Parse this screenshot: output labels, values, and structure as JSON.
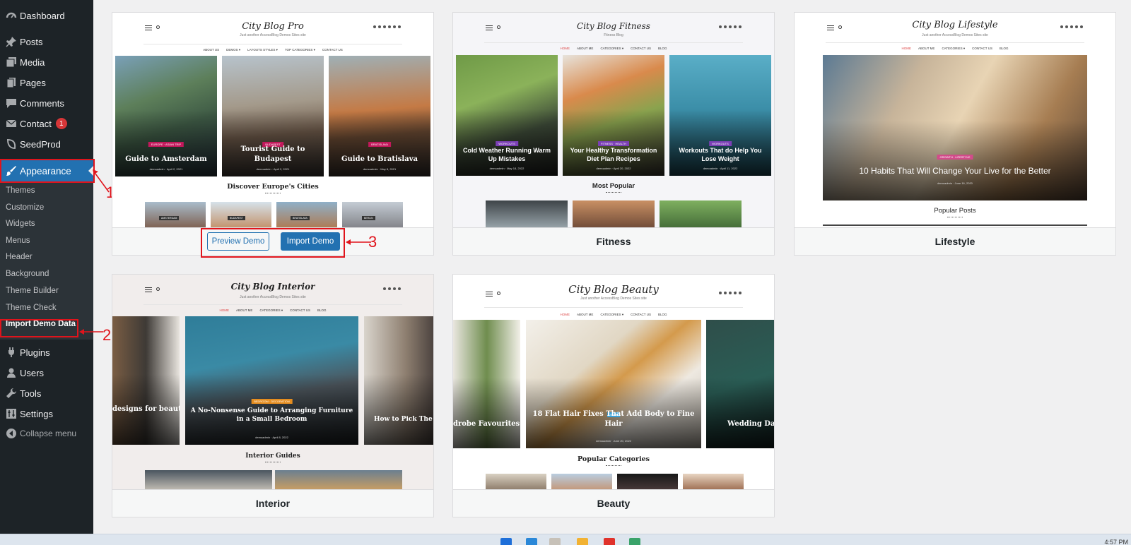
{
  "sidebar": {
    "menu": [
      {
        "label": "Dashboard",
        "icon": "dashboard-icon"
      },
      {
        "label": "Posts",
        "icon": "pin-icon"
      },
      {
        "label": "Media",
        "icon": "media-icon"
      },
      {
        "label": "Pages",
        "icon": "pages-icon"
      },
      {
        "label": "Comments",
        "icon": "comments-icon"
      },
      {
        "label": "Contact",
        "icon": "mail-icon",
        "badge": "1"
      },
      {
        "label": "SeedProd",
        "icon": "seedprod-icon"
      },
      {
        "label": "Appearance",
        "icon": "brush-icon"
      },
      {
        "label": "Plugins",
        "icon": "plugin-icon"
      },
      {
        "label": "Users",
        "icon": "users-icon"
      },
      {
        "label": "Tools",
        "icon": "wrench-icon"
      },
      {
        "label": "Settings",
        "icon": "settings-icon"
      },
      {
        "label": "Collapse menu",
        "icon": "collapse-icon"
      }
    ],
    "submenu": [
      "Themes",
      "Customize",
      "Widgets",
      "Menus",
      "Header",
      "Background",
      "Theme Builder",
      "Theme Check",
      "Import Demo Data"
    ]
  },
  "annotations": {
    "one": "1",
    "two": "2",
    "three": "3"
  },
  "cards": {
    "pro": {
      "name": "",
      "site_title": "City Blog Pro",
      "tagline": "Just another AccessBlog Demos Sites site",
      "nav": [
        "ABOUT US",
        "DEMOS ▾",
        "LAYOUTS STYLES ▾",
        "TOP CATEGORIES ▾",
        "CONTACT US"
      ],
      "posts": [
        {
          "title": "Guide to Amsterdam",
          "tag": "EUROPE · ASIAN TRIP",
          "meta": "demoadmin · April 2, 2021"
        },
        {
          "title": "Tourist Guide to Budapest",
          "tag": "BUDAPEST",
          "meta": "demoadmin · April 2, 2021"
        },
        {
          "title": "Guide to Bratislava",
          "tag": "BRATISLAVA",
          "meta": "demoadmin · May 8, 2021"
        }
      ],
      "section": "Discover Europe's Cities",
      "mini_labels": [
        "AMSTERDAM",
        "BUDAPEST",
        "BRATISLAVA",
        "BERLIN"
      ],
      "preview_label": "Preview Demo",
      "import_label": "Import Demo"
    },
    "fitness": {
      "name": "Fitness",
      "site_title": "City Blog Fitness",
      "tagline": "Fitness Blog",
      "nav": [
        "HOME",
        "ABOUT ME",
        "CATEGORIES ▾",
        "CONTACT US",
        "BLOG"
      ],
      "posts": [
        {
          "title": "Cold Weather Running Warm Up Mistakes",
          "tag": "WORKOUTS",
          "meta": "demoadmin · May 18, 2022"
        },
        {
          "title": "Your Healthy Transformation Diet Plan Recipes",
          "tag": "FITNESS · HEALTH",
          "meta": "demoadmin · April 20, 2022"
        },
        {
          "title": "Workouts That do Help You Lose Weight",
          "tag": "WORKOUTS",
          "meta": "demoadmin · April 11, 2022"
        }
      ],
      "section": "Most Popular"
    },
    "lifestyle": {
      "name": "Lifestyle",
      "site_title": "City Blog Lifestyle",
      "tagline": "Just another AccessBlog Demos Sites site",
      "nav": [
        "HOME",
        "ABOUT ME",
        "CATEGORIES ▾",
        "CONTACT US",
        "BLOG"
      ],
      "post": {
        "title": "10 Habits That Will Change Your Live for the Better",
        "tag": "GROWTH · LIFESTYLE",
        "meta": "demoadmin · June 16, 2020"
      },
      "section": "Popular Posts"
    },
    "interior": {
      "name": "Interior",
      "site_title": "City Blog Interior",
      "tagline": "Just another AccessBlog Demos Sites site",
      "nav": [
        "HOME",
        "ABOUT ME",
        "CATEGORIES ▾",
        "CONTACT US",
        "BLOG"
      ],
      "posts": [
        {
          "title": "designs for beautiful"
        },
        {
          "title": "A No-Nonsense Guide to Arranging Furniture in a Small Bedroom",
          "tag": "BEDROOM · DECORATION",
          "meta": "demoadmin · April 8, 2022"
        },
        {
          "title": "How to Pick The Rig"
        }
      ],
      "section": "Interior Guides"
    },
    "beauty": {
      "name": "Beauty",
      "site_title": "City Blog Beauty",
      "tagline": "Just another AccessBlog Demos Sites site",
      "nav": [
        "HOME",
        "ABOUT ME",
        "CATEGORIES ▾",
        "CONTACT US",
        "BLOG"
      ],
      "posts": [
        {
          "title": "drobe Favourites"
        },
        {
          "title": "18 Flat Hair Fixes That Add Body to Fine Hair",
          "tag": "HAIR",
          "meta": "demoadmin · June 20, 2022"
        },
        {
          "title": "Wedding Day M"
        }
      ],
      "section": "Popular Categories"
    }
  },
  "taskbar": {
    "time": "4:57 PM"
  },
  "colors": {
    "sidebar": "#1d2327",
    "accent": "#2271b1",
    "annotation": "#e0141c"
  }
}
